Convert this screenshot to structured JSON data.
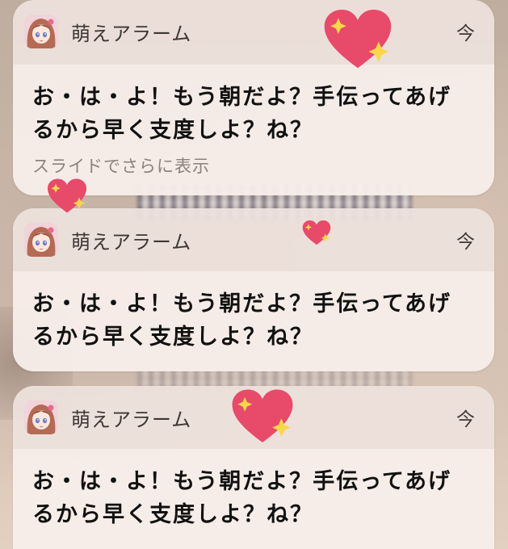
{
  "notifications": [
    {
      "app_name": "萌えアラーム",
      "time": "今",
      "message": "お・は・よ！もう朝だよ？手伝ってあげるから早く支度しよ？ね？",
      "more_label": "スライドでさらに表示"
    },
    {
      "app_name": "萌えアラーム",
      "time": "今",
      "message": "お・は・よ！もう朝だよ？手伝ってあげるから早く支度しよ？ね？"
    },
    {
      "app_name": "萌えアラーム",
      "time": "今",
      "message": "お・は・よ！もう朝だよ？手伝ってあげるから早く支度しよ？ね？"
    }
  ],
  "decorations": {
    "heart_color": "#e84a6a",
    "sparkle_color": "#f8d84a",
    "icons": [
      "anime-girl-app-icon",
      "heart-sparkle-sticker"
    ]
  }
}
